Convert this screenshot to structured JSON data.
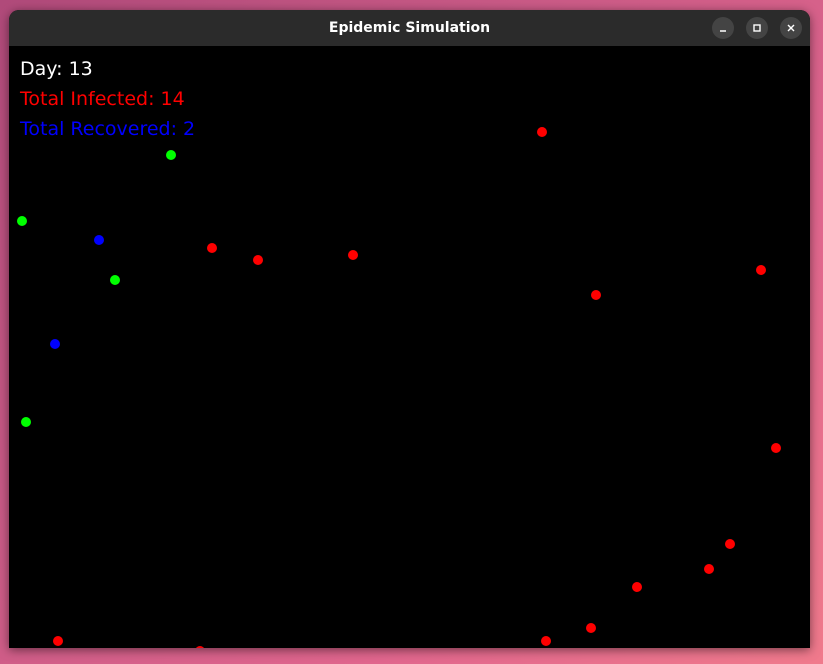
{
  "window": {
    "title": "Epidemic Simulation",
    "controls": {
      "minimize": "minimize-icon",
      "maximize": "maximize-icon",
      "close": "close-icon"
    }
  },
  "hud": {
    "day": "Day: 13",
    "total_infected": "Total Infected: 14",
    "total_recovered": "Total Recovered: 2"
  },
  "colors": {
    "healthy": "#00ff00",
    "infected": "#ff0000",
    "recovered": "#0000ff"
  }
}
